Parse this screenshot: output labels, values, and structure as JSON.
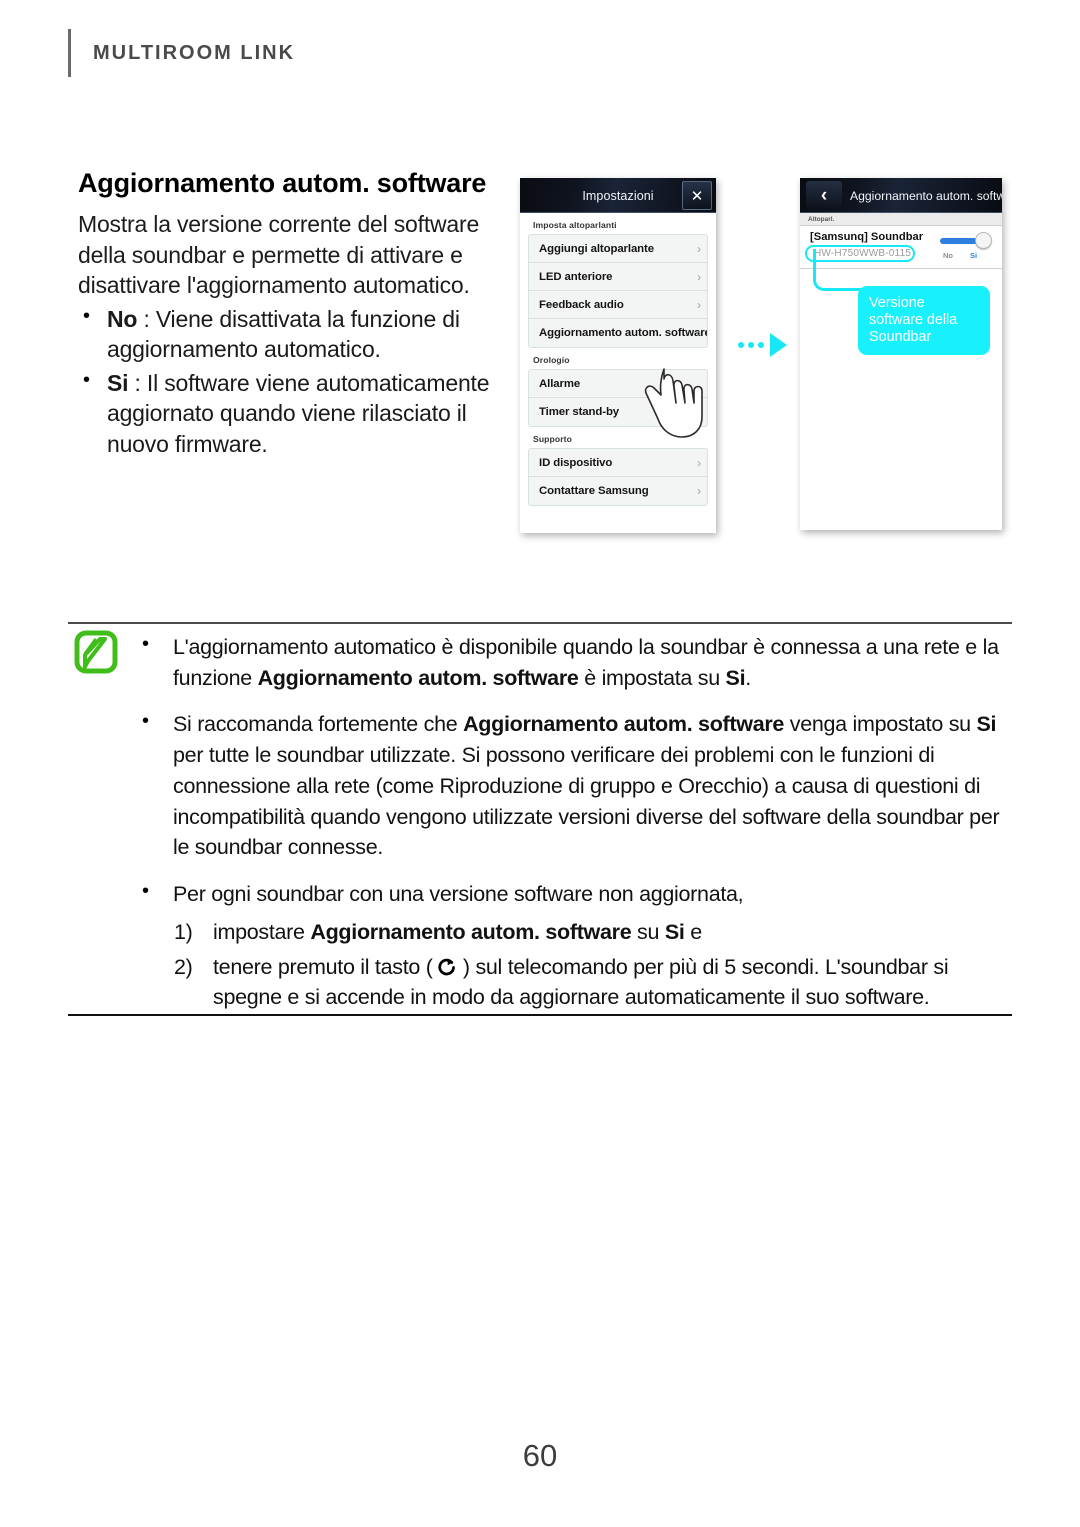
{
  "running_head": "MULTIROOM LINK",
  "page_number": "60",
  "colors": {
    "accent_cyan": "#18e8f5",
    "note_icon_green": "#3fbe1a",
    "toggle_blue": "#2f7fe0",
    "rule_gray": "#4a4a4a"
  },
  "lead": {
    "title": "Aggiornamento autom. software",
    "paragraph": "Mostra la versione corrente del software della soundbar e permette di attivare e disattivare l'aggiornamento automatico.",
    "options": [
      {
        "term": "No",
        "sep": " : ",
        "text": "Viene disattivata la funzione di aggiornamento automatico."
      },
      {
        "term": "Si",
        "sep": " : ",
        "text": "Il software viene automaticamente aggiornato quando viene rilasciato il nuovo firmware."
      }
    ]
  },
  "screenshot_settings": {
    "header_title": "Impostazioni",
    "close_icon": "close-icon",
    "sections": [
      {
        "label": "Imposta altoparlanti",
        "rows": [
          {
            "label": "Aggiungi altoparlante",
            "chevron": "›"
          },
          {
            "label": "LED anteriore",
            "chevron": "›"
          },
          {
            "label": "Feedback audio",
            "chevron": "›"
          },
          {
            "label": "Aggiornamento autom. software",
            "chevron": "›"
          }
        ]
      },
      {
        "label": "Orologio",
        "rows": [
          {
            "label": "Allarme",
            "chevron": ""
          },
          {
            "label": "Timer stand-by",
            "chevron": "›"
          }
        ]
      },
      {
        "label": "Supporto",
        "rows": [
          {
            "label": "ID dispositivo",
            "chevron": "›"
          },
          {
            "label": "Contattare Samsung",
            "chevron": "›"
          }
        ]
      }
    ]
  },
  "screenshot_update": {
    "back_icon": "back-chevron-icon",
    "header_title": "Aggiornamento autom. software",
    "section_label": "Altoparl.",
    "device_name": "[Samsunq] Soundbar",
    "device_version": "HW-H750WWB-0115",
    "toggle": {
      "off_label": "No",
      "on_label": "Si",
      "state": "on"
    },
    "callout": "Versione software della Soundbar"
  },
  "transition_arrow": "flow-arrow-icon",
  "note": {
    "icon": "note-pencil-icon",
    "items": [
      {
        "parts": [
          {
            "t": "L'aggiornamento automatico è disponibile quando la soundbar è connessa a una rete e la funzione ",
            "b": false
          },
          {
            "t": "Aggiornamento autom. software",
            "b": true
          },
          {
            "t": " è impostata su ",
            "b": false
          },
          {
            "t": "Si",
            "b": true
          },
          {
            "t": ".",
            "b": false
          }
        ]
      },
      {
        "parts": [
          {
            "t": "Si raccomanda fortemente che ",
            "b": false
          },
          {
            "t": "Aggiornamento autom. software",
            "b": true
          },
          {
            "t": " venga impostato su ",
            "b": false
          },
          {
            "t": "Si",
            "b": true
          },
          {
            "t": " per tutte le soundbar utilizzate. Si possono verificare dei problemi con le funzioni di connessione alla rete (come Riproduzione di gruppo e Orecchio) a causa di questioni di incompatibilità quando vengono utilizzate versioni diverse del software della soundbar per le soundbar connesse.",
            "b": false
          }
        ]
      },
      {
        "parts": [
          {
            "t": "Per ogni soundbar con una versione software non aggiornata,",
            "b": false
          }
        ],
        "sub_items": [
          {
            "number": "1)",
            "parts": [
              {
                "t": "impostare ",
                "b": false
              },
              {
                "t": "Aggiornamento autom. software",
                "b": true
              },
              {
                "t": " su ",
                "b": false
              },
              {
                "t": "Si",
                "b": true
              },
              {
                "t": " e",
                "b": false
              }
            ]
          },
          {
            "number": "2)",
            "parts": [
              {
                "t": "tenere premuto il tasto ( ",
                "b": false
              },
              {
                "icon": "power-refresh-icon"
              },
              {
                "t": " ) sul telecomando per più di 5 secondi. L'soundbar si spegne e si accende in modo da aggiornare automaticamente il suo software.",
                "b": false
              }
            ]
          }
        ]
      }
    ]
  }
}
